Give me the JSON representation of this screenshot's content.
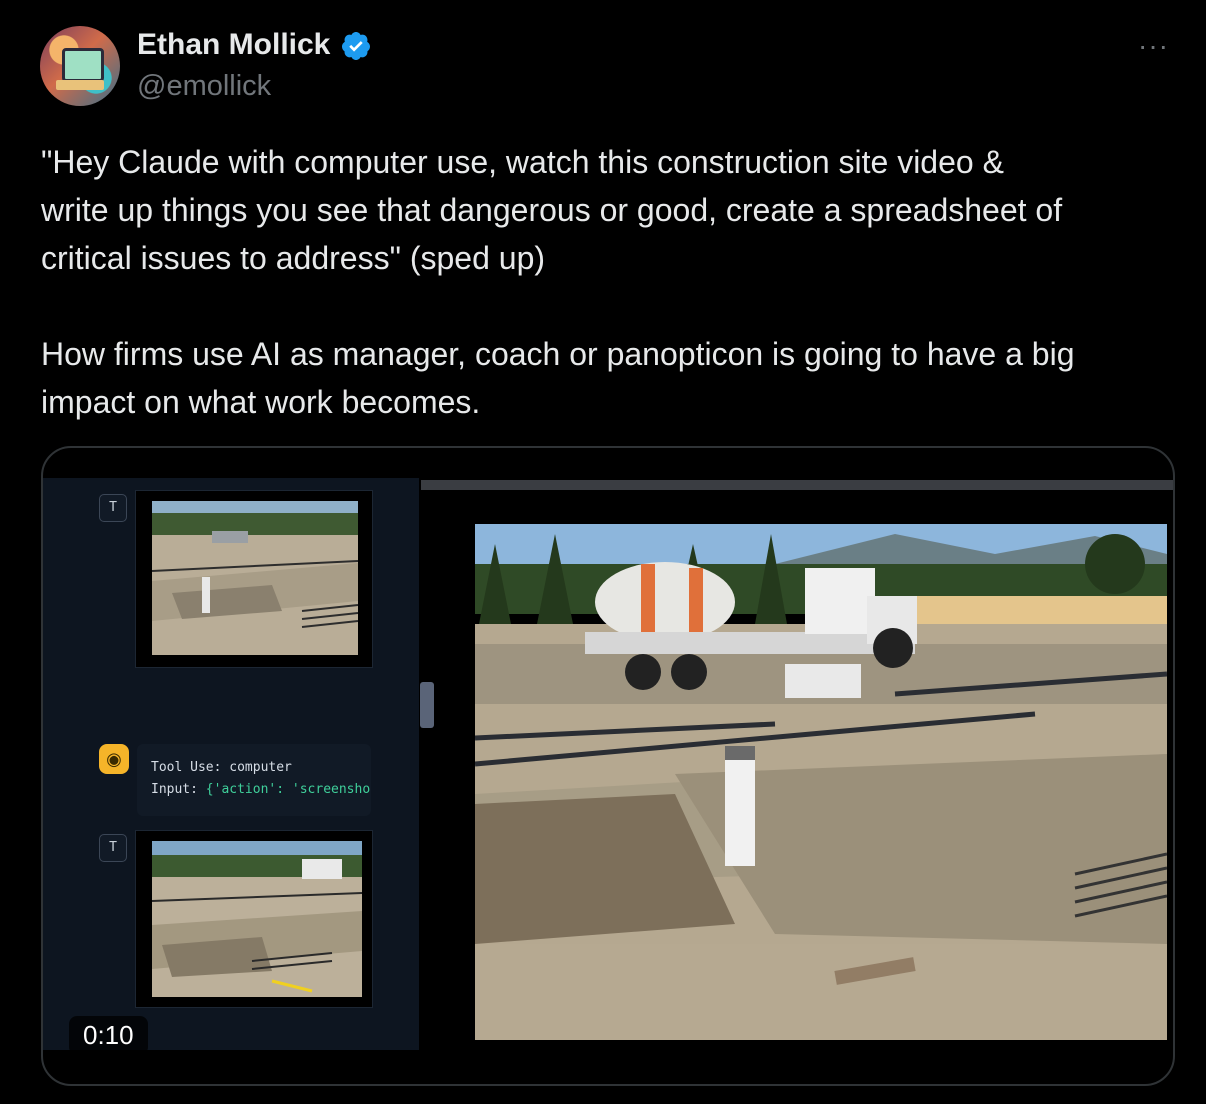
{
  "author": {
    "name": "Ethan Mollick",
    "handle": "@emollick",
    "verified": true
  },
  "more_icon": "···",
  "tweet": {
    "paragraph1": "\"Hey Claude with computer use, watch this construction site video &\nwrite up things you see that dangerous or good, create a spreadsheet of\ncritical issues to address\" (sped up)",
    "paragraph2": "How firms use AI as manager, coach or panopticon is going to have a big\nimpact on what work becomes."
  },
  "media": {
    "duration": "0:10",
    "panel": {
      "badge_top": "T",
      "badge_bottom": "T",
      "tool_use_label": "Tool Use: computer",
      "input_label": "Input: ",
      "input_value": "{'action': 'screensho"
    }
  },
  "colors": {
    "background": "#000000",
    "text": "#e7e9ea",
    "secondary": "#71767b",
    "verified": "#1d9bf0",
    "bot_icon": "#f5b429"
  }
}
